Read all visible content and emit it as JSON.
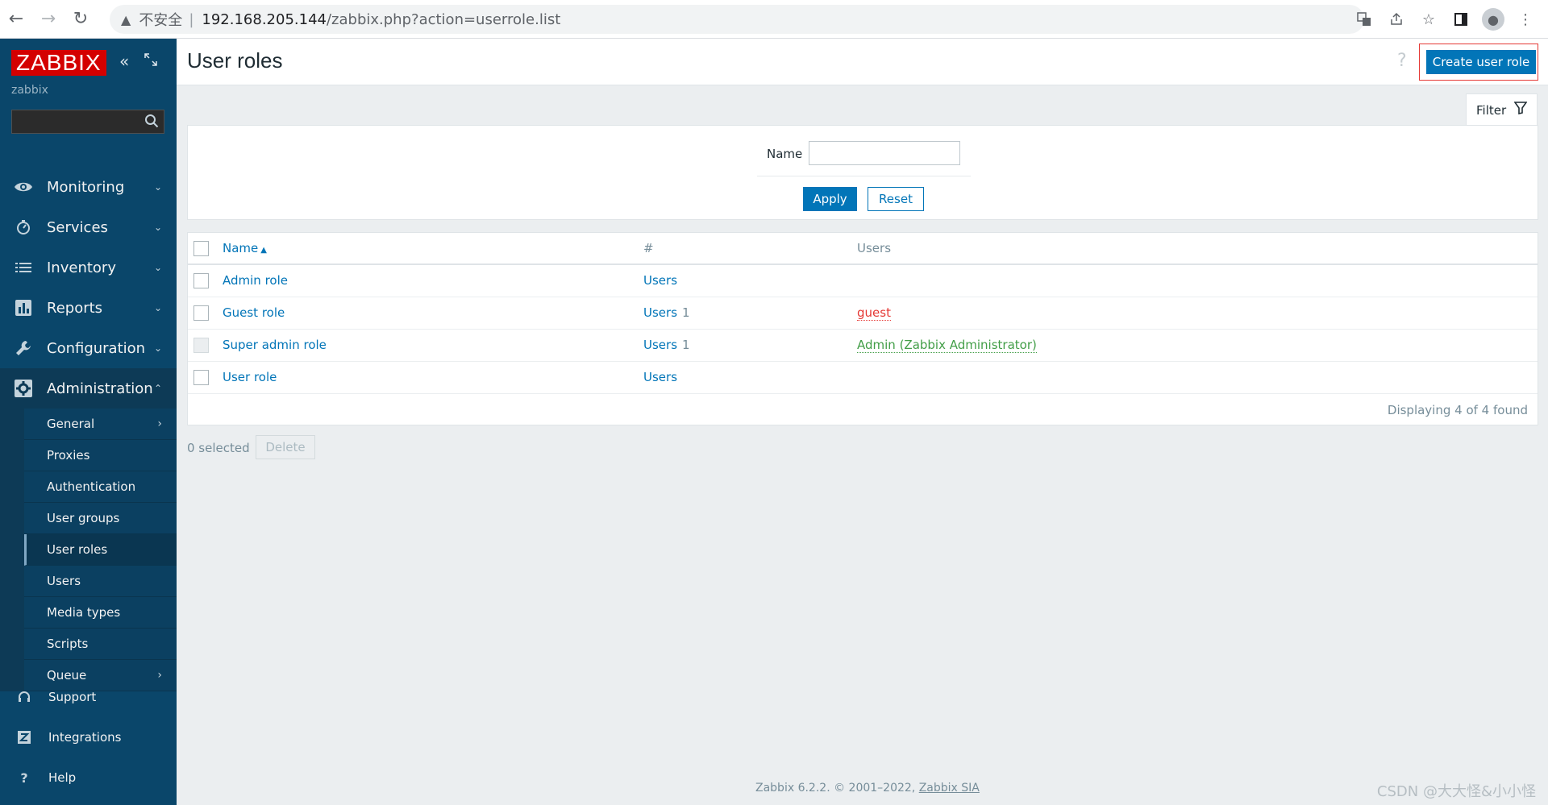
{
  "browser": {
    "insecure_label": "不安全",
    "separator": "|",
    "url_host": "192.168.205.144",
    "url_path": "/zabbix.php?action=userrole.list"
  },
  "sidebar": {
    "logo": "ZABBIX",
    "server_name": "zabbix",
    "search_placeholder": "",
    "menu": [
      {
        "label": "Monitoring",
        "icon": "eye-icon"
      },
      {
        "label": "Services",
        "icon": "clock-icon"
      },
      {
        "label": "Inventory",
        "icon": "list-icon"
      },
      {
        "label": "Reports",
        "icon": "bar-chart-icon"
      },
      {
        "label": "Configuration",
        "icon": "wrench-icon"
      },
      {
        "label": "Administration",
        "icon": "gear-icon"
      }
    ],
    "admin_submenu": [
      {
        "label": "General"
      },
      {
        "label": "Proxies"
      },
      {
        "label": "Authentication"
      },
      {
        "label": "User groups"
      },
      {
        "label": "User roles"
      },
      {
        "label": "Users"
      },
      {
        "label": "Media types"
      },
      {
        "label": "Scripts"
      },
      {
        "label": "Queue"
      }
    ],
    "bottom": [
      {
        "label": "Support",
        "icon": "headset-icon"
      },
      {
        "label": "Integrations",
        "icon": "z-icon"
      },
      {
        "label": "Help",
        "icon": "question-icon"
      }
    ]
  },
  "header": {
    "title": "User roles",
    "create_button": "Create user role"
  },
  "filter": {
    "tab_label": "Filter",
    "name_label": "Name",
    "name_value": "",
    "apply": "Apply",
    "reset": "Reset"
  },
  "table": {
    "columns": {
      "name": "Name",
      "count": "#",
      "users": "Users"
    },
    "rows": [
      {
        "name": "Admin role",
        "users_link": "Users",
        "count": "",
        "users": ""
      },
      {
        "name": "Guest role",
        "users_link": "Users",
        "count": "1",
        "users": "guest"
      },
      {
        "name": "Super admin role",
        "users_link": "Users",
        "count": "1",
        "users": "Admin (Zabbix Administrator)"
      },
      {
        "name": "User role",
        "users_link": "Users",
        "count": "",
        "users": ""
      }
    ],
    "footer": "Displaying 4 of 4 found"
  },
  "actions": {
    "selected": "0 selected",
    "delete": "Delete"
  },
  "footer": {
    "text": "Zabbix 6.2.2. © 2001–2022,",
    "link": "Zabbix SIA"
  },
  "watermark": "CSDN @大大怪&小小怪",
  "colors": {
    "sidebar": "#0a466a",
    "primary": "#0275b8",
    "logo": "#d40000",
    "user_red": "#e53935",
    "user_green": "#429e47"
  }
}
